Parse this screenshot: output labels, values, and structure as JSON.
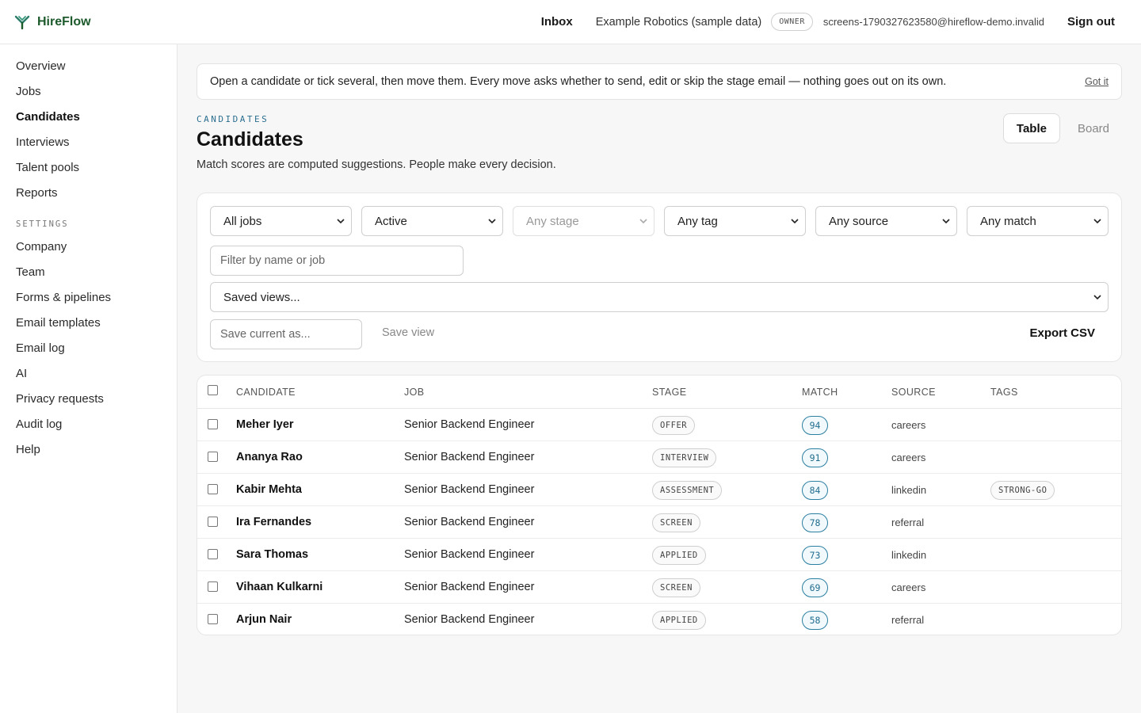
{
  "brand": {
    "name": "HireFlow"
  },
  "header": {
    "inbox_label": "Inbox",
    "org_name": "Example Robotics (sample data)",
    "role_badge": "OWNER",
    "user_email": "screens-1790327623580@hireflow-demo.invalid",
    "sign_out_label": "Sign out"
  },
  "sidebar": {
    "items": [
      {
        "label": "Overview"
      },
      {
        "label": "Jobs"
      },
      {
        "label": "Candidates",
        "active": true
      },
      {
        "label": "Interviews"
      },
      {
        "label": "Talent pools"
      },
      {
        "label": "Reports"
      }
    ],
    "settings_heading": "SETTINGS",
    "settings_items": [
      {
        "label": "Company"
      },
      {
        "label": "Team"
      },
      {
        "label": "Forms & pipelines"
      },
      {
        "label": "Email templates"
      },
      {
        "label": "Email log"
      },
      {
        "label": "AI"
      },
      {
        "label": "Privacy requests"
      },
      {
        "label": "Audit log"
      },
      {
        "label": "Help"
      }
    ]
  },
  "banner": {
    "text": "Open a candidate or tick several, then move them. Every move asks whether to send, edit or skip the stage email — nothing goes out on its own.",
    "dismiss_label": "Got it"
  },
  "page": {
    "eyebrow": "CANDIDATES",
    "title": "Candidates",
    "subtitle": "Match scores are computed suggestions. People make every decision."
  },
  "view_toggle": {
    "table_label": "Table",
    "board_label": "Board",
    "selected": "Table"
  },
  "filters": {
    "jobs": "All jobs",
    "status": "Active",
    "stage": "Any stage",
    "tag": "Any tag",
    "source": "Any source",
    "match": "Any match",
    "search_placeholder": "Filter by name or job",
    "saved_views": "Saved views...",
    "save_as_placeholder": "Save current as...",
    "save_view_label": "Save view",
    "export_label": "Export CSV"
  },
  "table": {
    "columns": [
      "CANDIDATE",
      "JOB",
      "STAGE",
      "MATCH",
      "SOURCE",
      "TAGS"
    ],
    "rows": [
      {
        "name": "Meher Iyer",
        "job": "Senior Backend Engineer",
        "stage": "OFFER",
        "match": "94",
        "source": "careers",
        "tag": ""
      },
      {
        "name": "Ananya Rao",
        "job": "Senior Backend Engineer",
        "stage": "INTERVIEW",
        "match": "91",
        "source": "careers",
        "tag": ""
      },
      {
        "name": "Kabir Mehta",
        "job": "Senior Backend Engineer",
        "stage": "ASSESSMENT",
        "match": "84",
        "source": "linkedin",
        "tag": "STRONG-GO"
      },
      {
        "name": "Ira Fernandes",
        "job": "Senior Backend Engineer",
        "stage": "SCREEN",
        "match": "78",
        "source": "referral",
        "tag": ""
      },
      {
        "name": "Sara Thomas",
        "job": "Senior Backend Engineer",
        "stage": "APPLIED",
        "match": "73",
        "source": "linkedin",
        "tag": ""
      },
      {
        "name": "Vihaan Kulkarni",
        "job": "Senior Backend Engineer",
        "stage": "SCREEN",
        "match": "69",
        "source": "careers",
        "tag": ""
      },
      {
        "name": "Arjun Nair",
        "job": "Senior Backend Engineer",
        "stage": "APPLIED",
        "match": "58",
        "source": "referral",
        "tag": ""
      }
    ]
  },
  "colors": {
    "brand": "#1d5a2c",
    "accent": "#2b7fa0",
    "eyebrow": "#2b6f8f"
  }
}
